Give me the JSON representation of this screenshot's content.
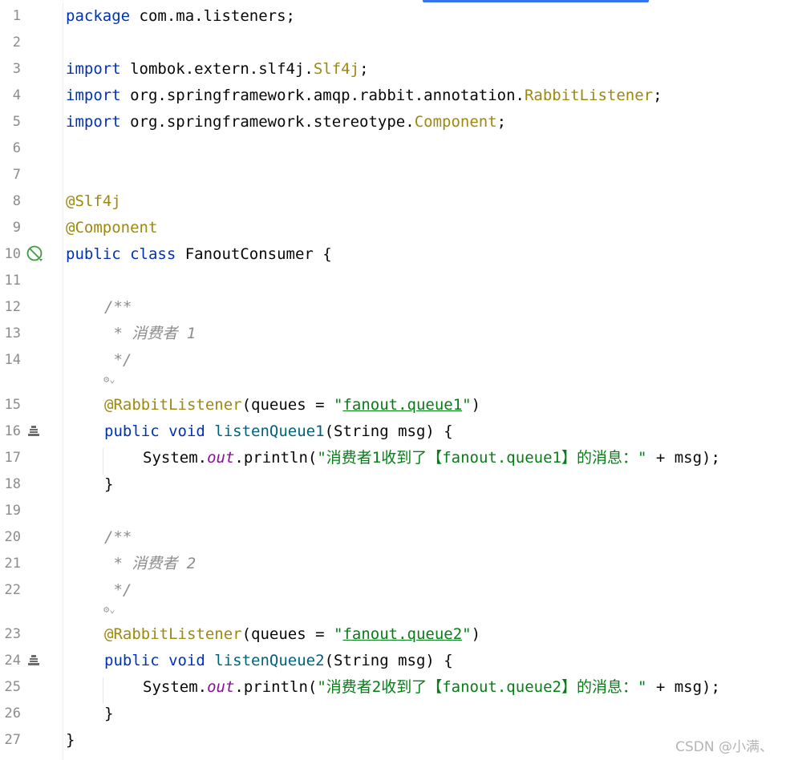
{
  "editor": {
    "line_numbers": [
      "1",
      "2",
      "3",
      "4",
      "5",
      "6",
      "7",
      "8",
      "9",
      "10",
      "11",
      "12",
      "13",
      "14",
      "15",
      "16",
      "17",
      "18",
      "19",
      "20",
      "21",
      "22",
      "23",
      "24",
      "25",
      "26",
      "27"
    ],
    "code": {
      "l1_kw": "package",
      "l1_rest": " com.ma.listeners;",
      "l3_kw": "import",
      "l3_rest": " lombok.extern.slf4j.",
      "l3_cls": "Slf4j",
      "l3_end": ";",
      "l4_kw": "import",
      "l4_rest": " org.springframework.amqp.rabbit.annotation.",
      "l4_cls": "RabbitListener",
      "l4_end": ";",
      "l5_kw": "import",
      "l5_rest": " org.springframework.stereotype.",
      "l5_cls": "Component",
      "l5_end": ";",
      "l8_ann": "@Slf4j",
      "l9_ann": "@Component",
      "l10_kw": "public class",
      "l10_rest": " FanoutConsumer {",
      "l12_cmt": "/**",
      "l13_cmt": " * 消费者 1",
      "l14_cmt": " */",
      "l15_ann": "@RabbitListener",
      "l15_a": "(queues = ",
      "l15_q1": "\"",
      "l15_link": "fanout.queue1",
      "l15_q2": "\"",
      "l15_end": ")",
      "l16_kw": "public void",
      "l16_sp": " ",
      "l16_meth": "listenQueue1",
      "l16_rest": "(String msg) {",
      "l17_a": "System.",
      "l17_fld": "out",
      "l17_b": ".println(",
      "l17_str": "\"消费者1收到了【fanout.queue1】的消息：\"",
      "l17_end": " + msg);",
      "l18": "}",
      "l20_cmt": "/**",
      "l21_cmt": " * 消费者 2",
      "l22_cmt": " */",
      "l23_ann": "@RabbitListener",
      "l23_a": "(queues = ",
      "l23_q1": "\"",
      "l23_link": "fanout.queue2",
      "l23_q2": "\"",
      "l23_end": ")",
      "l24_kw": "public void",
      "l24_sp": " ",
      "l24_meth": "listenQueue2",
      "l24_rest": "(String msg) {",
      "l25_a": "System.",
      "l25_fld": "out",
      "l25_b": ".println(",
      "l25_str": "\"消费者2收到了【fanout.queue2】的消息：\"",
      "l25_end": " + msg);",
      "l26": "}",
      "l27": "}"
    },
    "hints": {
      "h1": "⚙⌄",
      "h2": "⚙⌄"
    },
    "icons": [
      "spring-bean-icon",
      "method-run-icon",
      "method-run-icon"
    ]
  },
  "watermark": "CSDN @小满、",
  "colors": {
    "keyword": "#0033b3",
    "annotation": "#9e880d",
    "string": "#067d17",
    "comment": "#8c8c8c",
    "field": "#871094",
    "method": "#00627a",
    "tab_indicator": "#3574f0"
  }
}
